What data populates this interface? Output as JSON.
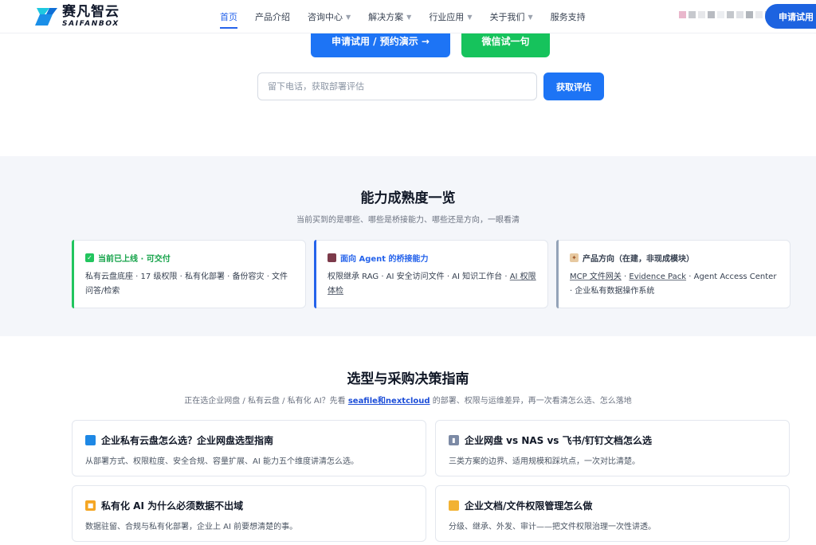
{
  "header": {
    "logo_cn": "赛凡智云",
    "logo_en": "SAIFANBOX",
    "nav": [
      {
        "label": "首页",
        "active": true,
        "dropdown": false
      },
      {
        "label": "产品介绍",
        "active": false,
        "dropdown": false
      },
      {
        "label": "咨询中心",
        "active": false,
        "dropdown": true
      },
      {
        "label": "解决方案",
        "active": false,
        "dropdown": true
      },
      {
        "label": "行业应用",
        "active": false,
        "dropdown": true
      },
      {
        "label": "关于我们",
        "active": false,
        "dropdown": true
      },
      {
        "label": "服务支持",
        "active": false,
        "dropdown": false
      }
    ],
    "apply_button": "申请试用"
  },
  "hero": {
    "cta_primary": "申请试用 / 预约演示 →",
    "cta_wechat": "微信试一句",
    "phone_placeholder": "留下电话，获取部署评估",
    "phone_button": "获取评估"
  },
  "maturity": {
    "title": "能力成熟度一览",
    "subtitle": "当前买到的是哪些、哪些是桥接能力、哪些还是方向，一眼看清",
    "cards": [
      {
        "title": "当前已上线 · 可交付",
        "icon": "check-icon",
        "color": "#16a34a",
        "body": "私有云盘底座 · 17 级权限 · 私有化部署 · 备份容灾 · 文件问答/检索"
      },
      {
        "title": "面向 Agent 的桥接能力",
        "icon": "book-icon",
        "color": "#2563eb",
        "body_a": "权限继承 RAG · AI 安全访问文件 · AI 知识工作台 · ",
        "body_b": "AI 权限体检"
      },
      {
        "title": "产品方向（在建，非现成模块）",
        "icon": "compass-icon",
        "color": "#94a3b8",
        "body_a": "MCP 文件网关",
        "body_sep": " · ",
        "body_b": "Evidence Pack",
        "body_c": " · Agent Access Center · 企业私有数据操作系统"
      }
    ]
  },
  "guide": {
    "title": "选型与采购决策指南",
    "subtitle_pre": "正在选企业网盘 / 私有云盘 / 私有化 AI？先看 ",
    "subtitle_link": "seafile和nextcloud",
    "subtitle_post": " 的部署、权限与运维差异，再一次看清怎么选、怎么落地",
    "cards": [
      {
        "icon": "book-icon",
        "color": "#1e88e5",
        "title": "企业私有云盘怎么选？企业网盘选型指南",
        "desc": "从部署方式、权限粒度、安全合规、容量扩展、AI 能力五个维度讲清怎么选。"
      },
      {
        "icon": "chart-icon",
        "color": "#7c8aa5",
        "title": "企业网盘 vs NAS vs 飞书/钉钉文档怎么选",
        "desc": "三类方案的边界、适用规模和踩坑点，一次对比清楚。"
      },
      {
        "icon": "lock-icon",
        "color": "#f5a623",
        "title": "私有化 AI 为什么必须数据不出域",
        "desc": "数据驻留、合规与私有化部署，企业上 AI 前要想清楚的事。"
      },
      {
        "icon": "folder-icon",
        "color": "#f2b233",
        "title": "企业文档/文件权限管理怎么做",
        "desc": "分级、继承、外发、审计——把文件权限治理一次性讲透。"
      }
    ]
  }
}
